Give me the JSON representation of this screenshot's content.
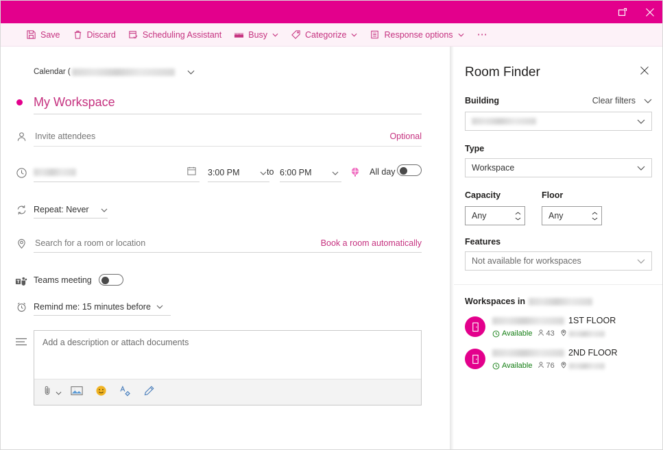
{
  "titlebar": {
    "popout_icon": "popout-icon",
    "close_icon": "close-icon"
  },
  "toolbar": {
    "save_label": "Save",
    "discard_label": "Discard",
    "scheduling_label": "Scheduling Assistant",
    "busy_label": "Busy",
    "categorize_label": "Categorize",
    "response_label": "Response options",
    "overflow_label": "⋯"
  },
  "form": {
    "calendar_label": "Calendar (",
    "title_value": "My Workspace",
    "attendees_placeholder": "Invite attendees",
    "optional_label": "Optional",
    "start_time": "3:00 PM",
    "to_label": "to",
    "end_time": "6:00 PM",
    "allday_label": "All day",
    "repeat_label": "Repeat: Never",
    "location_placeholder": "Search for a room or location",
    "book_room_link": "Book a room automatically",
    "teams_label": "Teams meeting",
    "remind_label": "Remind me: 15 minutes before",
    "description_placeholder": "Add a description or attach documents"
  },
  "room_finder": {
    "title": "Room Finder",
    "building_label": "Building",
    "clear_filters_label": "Clear filters",
    "type_label": "Type",
    "type_value": "Workspace",
    "capacity_label": "Capacity",
    "capacity_value": "Any",
    "floor_label": "Floor",
    "floor_value": "Any",
    "features_label": "Features",
    "features_value": "Not available for workspaces",
    "workspaces_header": "Workspaces in",
    "items": [
      {
        "name_suffix": "1ST FLOOR",
        "status": "Available",
        "capacity": "43"
      },
      {
        "name_suffix": "2ND FLOOR",
        "status": "Available",
        "capacity": "76"
      }
    ]
  },
  "colors": {
    "accent": "#e3008c",
    "command_text": "#c5317f",
    "available_green": "#107c10",
    "command_bar_bg": "#fdf2f8"
  }
}
